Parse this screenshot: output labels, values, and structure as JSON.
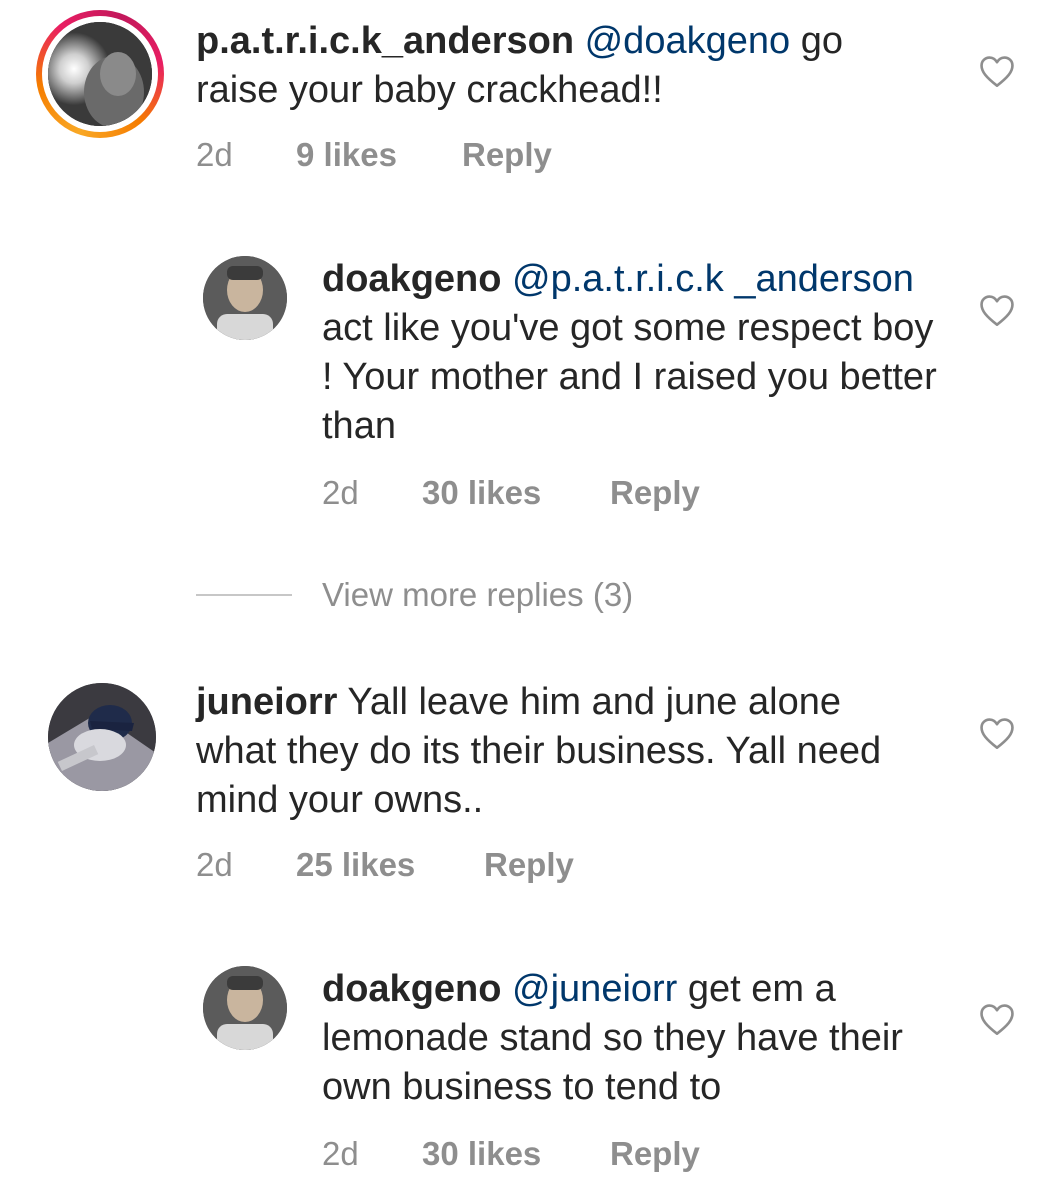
{
  "comments": [
    {
      "username": "p.a.t.r.i.c.k_anderson",
      "mention": "@doakgeno",
      "text": "go raise your baby crackhead!!",
      "time": "2d",
      "likes": "9 likes",
      "reply": "Reply"
    },
    {
      "username": "doakgeno",
      "mention": "@p.a.t.r.i.c.k _anderson",
      "text": "act like you've got some respect boy ! Your mother and I raised you better than",
      "time": "2d",
      "likes": "30 likes",
      "reply": "Reply"
    },
    {
      "username": "juneiorr",
      "mention": "",
      "text": "Yall leave him and june alone what they do its their business. Yall need mind your owns..",
      "time": "2d",
      "likes": "25 likes",
      "reply": "Reply"
    },
    {
      "username": "doakgeno",
      "mention": "@juneiorr",
      "text": "get em a lemonade stand so they have their own business to tend to",
      "time": "2d",
      "likes": "30 likes",
      "reply": "Reply"
    }
  ],
  "view_more": "View more replies (3)",
  "icons": {
    "like": "heart-icon"
  },
  "colors": {
    "mention": "#00376b",
    "meta": "#8e8e8e",
    "text": "#262626"
  }
}
